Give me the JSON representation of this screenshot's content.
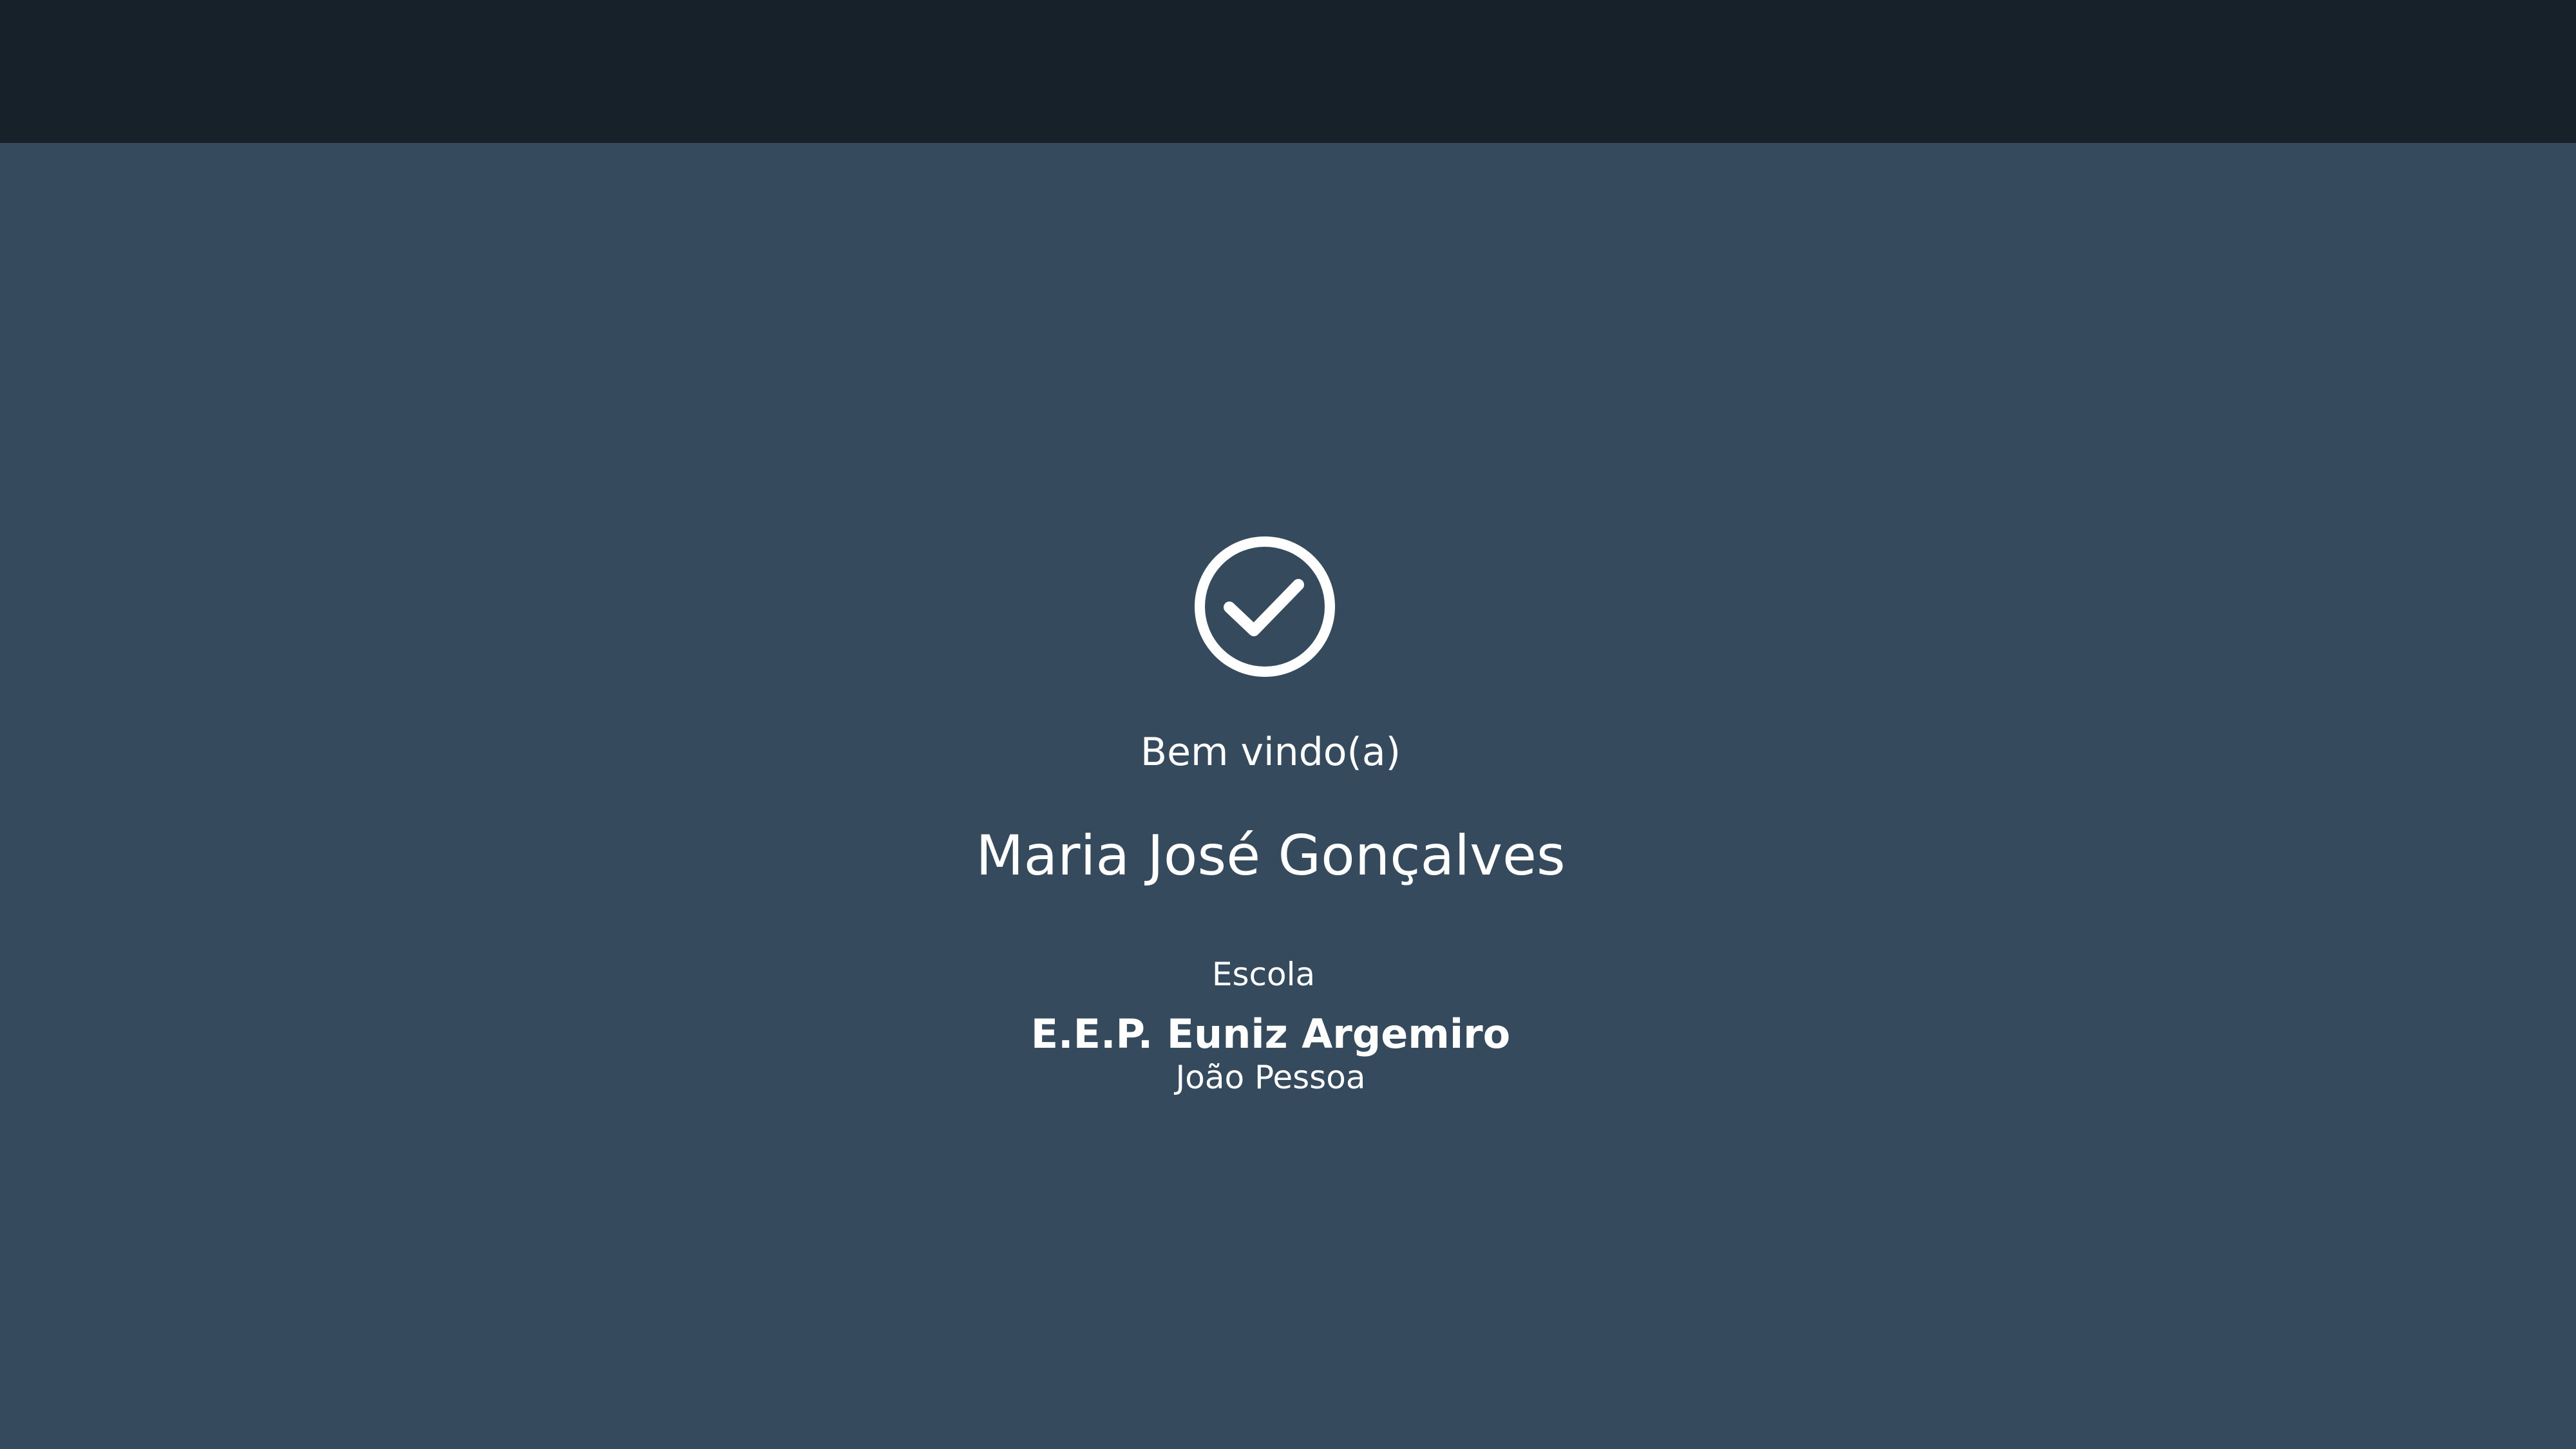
{
  "welcome": {
    "icon": "check-circle-icon",
    "greeting": "Bem vindo(a)",
    "user_name": "Maria José Gonçalves",
    "school_label": "Escola",
    "school_name": "E.E.P. Euniz Argemiro",
    "school_city": "João Pessoa"
  },
  "colors": {
    "top_bar": "#172129",
    "background": "#354a5c",
    "text": "#ffffff"
  }
}
